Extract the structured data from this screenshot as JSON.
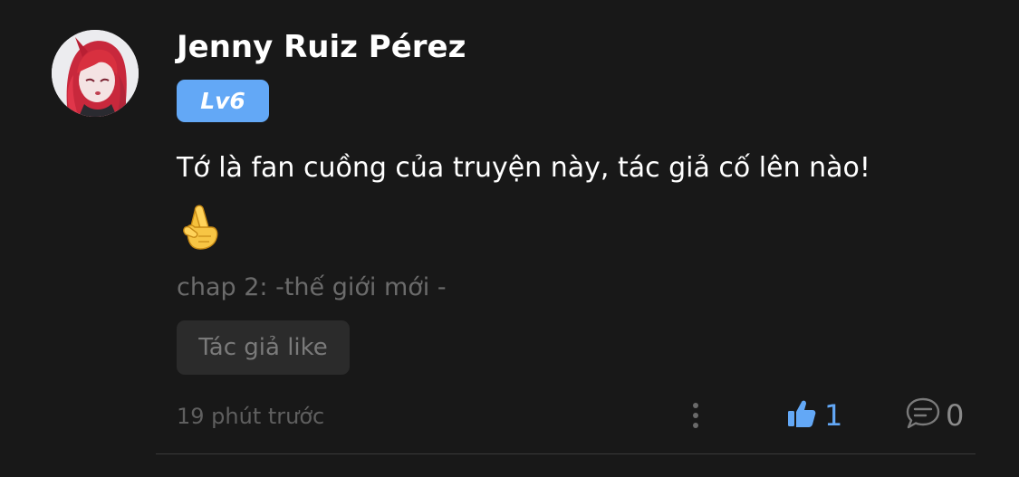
{
  "comment": {
    "username": "Jenny Ruiz Pérez",
    "level": "Lv6",
    "text": "Tớ là fan cuồng của truyện này, tác giả cố lên nào!",
    "chapter": "chap 2: -thế giới mới -",
    "author_like_label": "Tác giả like",
    "timestamp": "19 phút trước",
    "like_count": "1",
    "reply_count": "0"
  },
  "icons": {
    "avatar": "anime-avatar",
    "emoji": "crossed-fingers-icon",
    "more": "more-vertical-icon",
    "like": "thumbs-up-icon",
    "reply": "comment-bubble-icon"
  },
  "colors": {
    "background": "#181818",
    "accent": "#63a8f6",
    "muted": "#6b6b6b",
    "chip_background": "#2b2b2b"
  }
}
